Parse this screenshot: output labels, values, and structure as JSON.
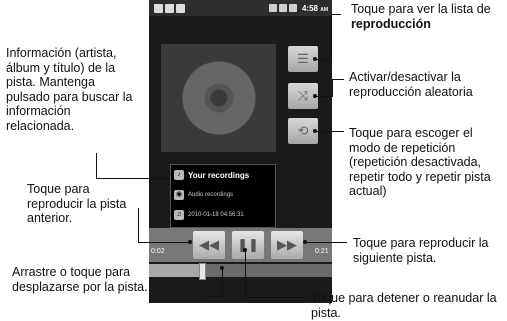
{
  "status_bar": {
    "time": "4:58",
    "ampm": "AM"
  },
  "track": {
    "title": "Your recordings",
    "album": "Audio recordings",
    "artist": "2010-01-18 04:56:31"
  },
  "times": {
    "elapsed": "0:02",
    "total": "0:21"
  },
  "progress": {
    "fraction": 0.29
  },
  "buttons": {
    "playlist": "☰",
    "shuffle": "⤨",
    "repeat": "⟲",
    "previous": "◀◀",
    "pause": "❚❚",
    "next": "▶▶"
  },
  "annotations": {
    "playlist_text": "Toque para ver la lista de",
    "playlist_bold": "reproducción",
    "shuffle": "Activar/desactivar la reproducción aleatoria",
    "repeat": "Toque para escoger el modo de repetición (repetición desactivada, repetir todo y repetir pista actual)",
    "info": "Información (artista, álbum y título) de la pista. Mantenga pulsado para buscar la información relacionada.",
    "previous": "Toque para reproducir la pista anterior.",
    "next": "Toque para reproducir la siguiente pista.",
    "seek": "Arrastre o toque para desplazarse por la pista.",
    "pause": "Toque para detener o reanudar la pista."
  }
}
